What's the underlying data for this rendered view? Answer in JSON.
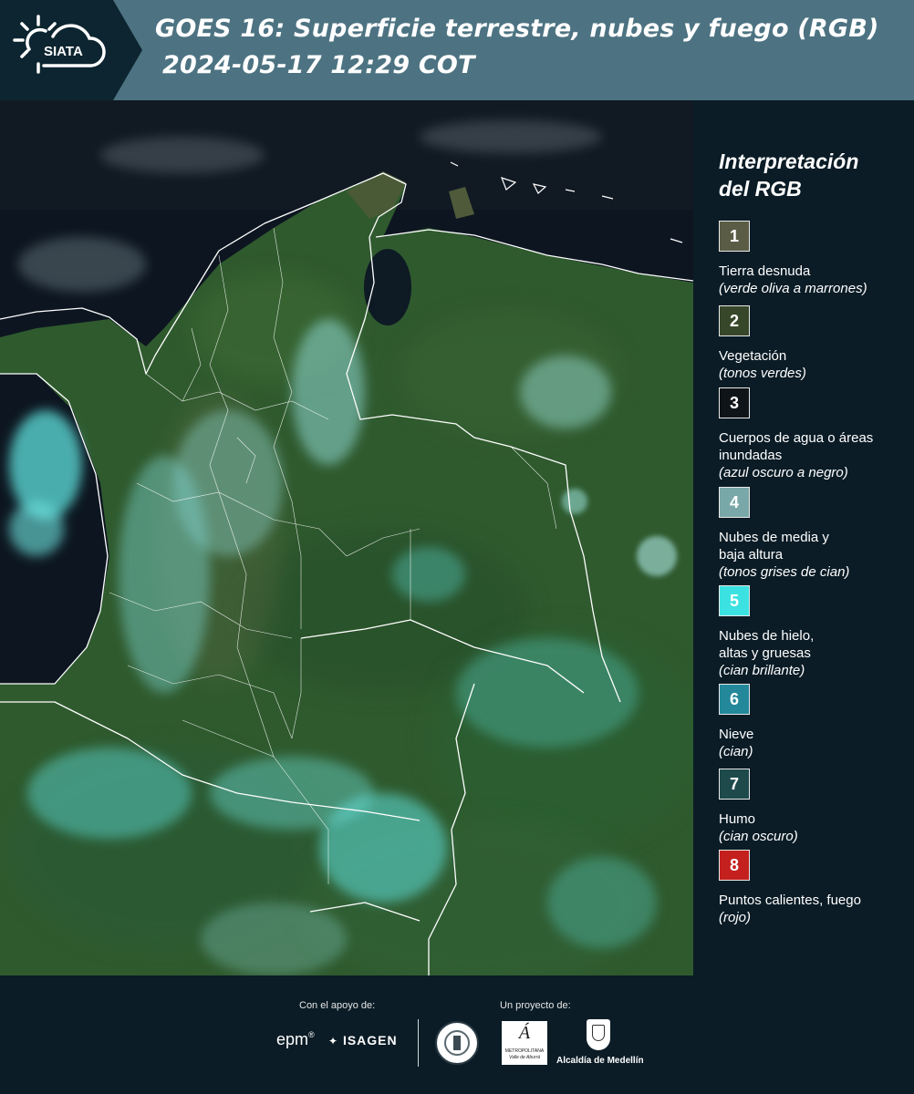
{
  "header": {
    "logo_text": "SIATA",
    "title": "GOES 16: Superficie terrestre, nubes y fuego (RGB)",
    "subtitle": "2024-05-17 12:29 COT"
  },
  "legend": {
    "title_line1": "Interpretación",
    "title_line2": "del RGB",
    "items": [
      {
        "num": "1",
        "color": "#5b5c45",
        "label": "Tierra desnuda",
        "sub": "(verde oliva a marrones)"
      },
      {
        "num": "2",
        "color": "#37472a",
        "label": "Vegetación",
        "sub": "(tonos verdes)"
      },
      {
        "num": "3",
        "color": "#0f1418",
        "label": "Cuerpos de agua o áreas inundadas",
        "sub": "(azul oscuro a negro)"
      },
      {
        "num": "4",
        "color": "#7aa8a8",
        "label": "Nubes de media y baja altura",
        "sub": "(tonos grises de cian)"
      },
      {
        "num": "5",
        "color": "#3ce2e2",
        "label": "Nubes de hielo, altas y gruesas",
        "sub": "(cian brillante)"
      },
      {
        "num": "6",
        "color": "#23889a",
        "label": "Nieve",
        "sub": "(cian)"
      },
      {
        "num": "7",
        "color": "#1e4a4c",
        "label": "Humo",
        "sub": "(cian oscuro)"
      },
      {
        "num": "8",
        "color": "#c4201e",
        "label": "Puntos calientes, fuego",
        "sub": "(rojo)"
      }
    ]
  },
  "footer": {
    "support_label": "Con el apoyo de:",
    "project_label": "Un proyecto de:",
    "sponsor_epm": "epm",
    "sponsor_isagen": "ISAGEN",
    "area_metro_line1": "METROPOLITANA",
    "area_metro_line2": "Valle de Aburrá",
    "alcaldia": "Alcaldía de Medellín"
  },
  "colors": {
    "header_bg": "#4d7382",
    "logo_bg": "#0d2530",
    "page_bg": "#0b1c26",
    "vegetation": "#2f5a2e",
    "cloud_cyan": "#5fe0dc",
    "ocean": "#0d1620"
  },
  "icons": [
    "siata-sun-cloud-logo",
    "epm-logo",
    "isagen-logo",
    "university-seal",
    "area-metropolitana-logo",
    "medellin-shield"
  ]
}
